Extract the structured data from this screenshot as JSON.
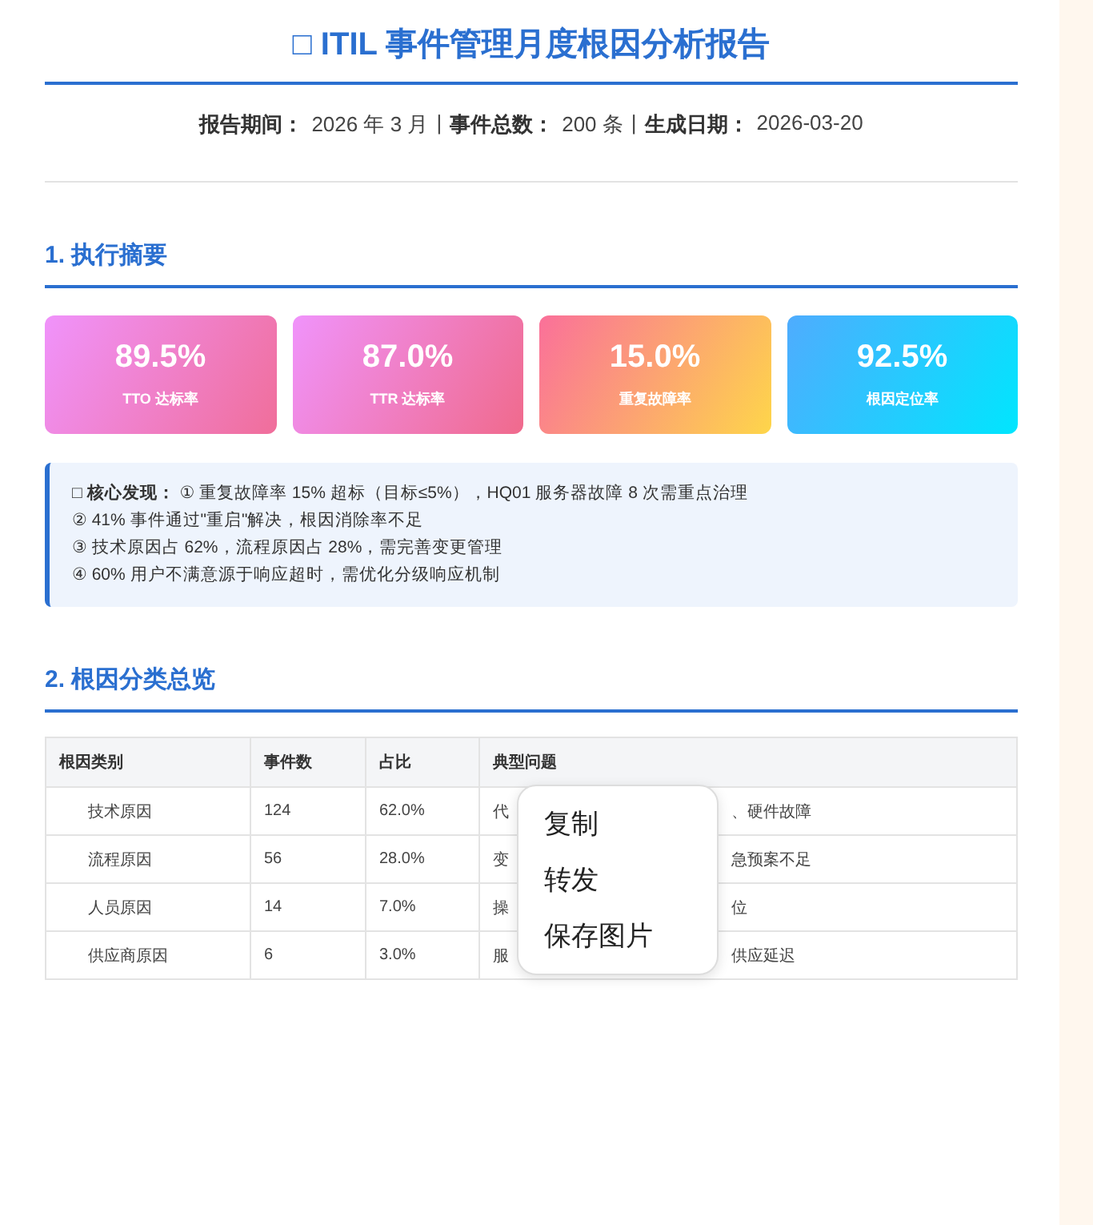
{
  "title": "□ ITIL 事件管理月度根因分析报告",
  "meta": [
    {
      "label": "报告期间：",
      "value": "2026 年 3 月"
    },
    {
      "label": "事件总数：",
      "value": "200 条"
    },
    {
      "label": "生成日期：",
      "value": "2026-03-20"
    }
  ],
  "meta_separator": "|",
  "sections": [
    {
      "heading": "1. 执行摘要"
    },
    {
      "heading": "2. 根因分类总览"
    }
  ],
  "kpi_cards": [
    {
      "value": "89.5%",
      "label": "TTO 达标率",
      "color": "#f06e9a"
    },
    {
      "value": "87.0%",
      "label": "TTR 达标率",
      "color": "#f06a8c"
    },
    {
      "value": "15.0%",
      "label": "重复故障率",
      "color": "#fed64a"
    },
    {
      "value": "92.5%",
      "label": "根因定位率",
      "color": "#00e6fe"
    }
  ],
  "findings": {
    "icon": "□",
    "label": "核心发现：",
    "lines": [
      "① 重复故障率 15% 超标（目标≤5%），HQ01 服务器故障 8 次需重点治理",
      "② 41% 事件通过\"重启\"解决，根因消除率不足",
      "③ 技术原因占 62%，流程原因占 28%，需完善变更管理",
      "④ 60% 用户不满意源于响应超时，需优化分级响应机制"
    ]
  },
  "table": {
    "columns": [
      "根因类别",
      "事件数",
      "占比",
      "典型问题"
    ],
    "rows": [
      {
        "category": "技术原因",
        "count": "124",
        "share": "62.0%",
        "issue_start": "代",
        "issue_end": "、硬件故障"
      },
      {
        "category": "流程原因",
        "count": "56",
        "share": "28.0%",
        "issue_start": "变",
        "issue_end": "急预案不足"
      },
      {
        "category": "人员原因",
        "count": "14",
        "share": "7.0%",
        "issue_start": "操",
        "issue_end": "位"
      },
      {
        "category": "供应商原因",
        "count": "6",
        "share": "3.0%",
        "issue_start": "服",
        "issue_end": "供应延迟"
      }
    ]
  },
  "context_menu": {
    "items": [
      "复制",
      "转发",
      "保存图片"
    ]
  }
}
